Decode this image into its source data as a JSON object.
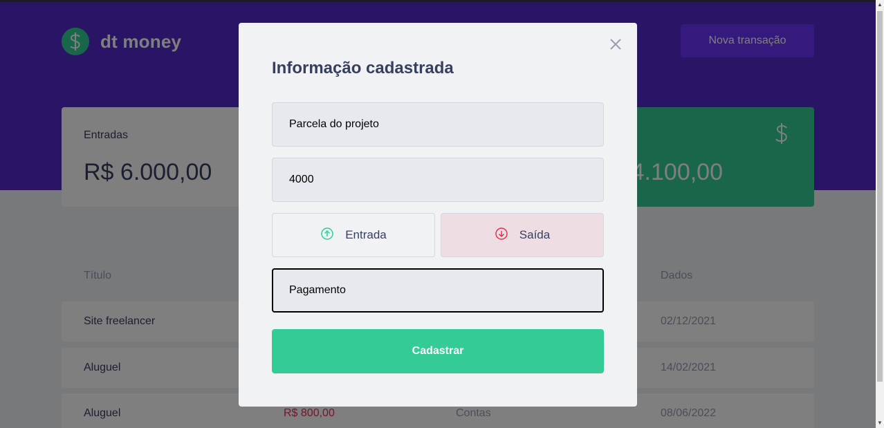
{
  "header": {
    "logo_symbol": "$",
    "logo_text": "dt money",
    "new_transaction_label": "Nova transação"
  },
  "summary": {
    "income": {
      "label": "Entradas",
      "value": "R$ 6.000,00"
    },
    "total": {
      "value": "4.100,00",
      "icon": "dollar-icon"
    }
  },
  "table": {
    "headers": {
      "title": "Título",
      "date": "Dados"
    },
    "rows": [
      {
        "title": "Site freelancer",
        "amount": "",
        "category": "",
        "date": "02/12/2021"
      },
      {
        "title": "Aluguel",
        "amount": "",
        "category": "",
        "date": "14/02/2021"
      },
      {
        "title": "Aluguel",
        "amount": "R$ 800,00",
        "category": "Contas",
        "date": "08/06/2022"
      }
    ]
  },
  "modal": {
    "title": "Informação cadastrada",
    "title_field_value": "Parcela do projeto",
    "amount_field_value": "4000",
    "type_income_label": "Entrada",
    "type_outcome_label": "Saída",
    "category_field_value": "Pagamento",
    "submit_label": "Cadastrar"
  },
  "colors": {
    "brand": "#5429cc",
    "green": "#33cc95",
    "red": "#e52e4d",
    "text": "#363f5f"
  }
}
